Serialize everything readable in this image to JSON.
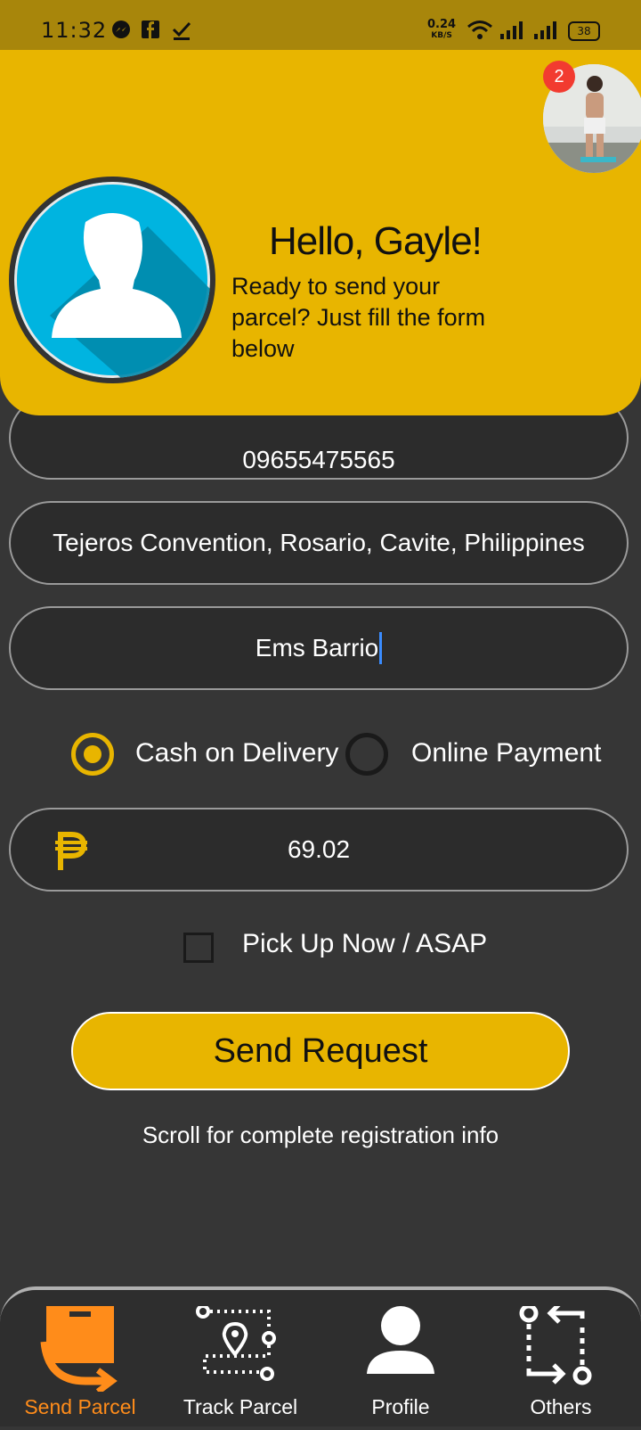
{
  "status_bar": {
    "time": "11:32",
    "speed_value": "0.24",
    "speed_unit": "KB/S",
    "battery": "38",
    "icons": [
      "messenger-icon",
      "facebook-icon",
      "check-icon",
      "wifi-icon",
      "signal-icon",
      "signal-icon",
      "battery-icon"
    ]
  },
  "header": {
    "notification_count": "2",
    "greeting": "Hello, Gayle!",
    "subtitle": "Ready to send your parcel? Just fill the form below"
  },
  "form": {
    "phone": "09655475565",
    "address": "Tejeros Convention, Rosario, Cavite, Philippines",
    "name": "Ems Barrio",
    "payment_options": [
      {
        "label": "Cash on Delivery",
        "selected": true
      },
      {
        "label": "Online Payment",
        "selected": false
      }
    ],
    "amount": "69.02",
    "currency_icon": "peso-icon",
    "pickup_label": "Pick Up Now / ASAP",
    "pickup_checked": false,
    "submit_label": "Send Request",
    "scroll_note": "Scroll for complete registration info"
  },
  "nav": {
    "items": [
      {
        "label": "Send Parcel",
        "icon": "parcel-icon",
        "active": true
      },
      {
        "label": "Track Parcel",
        "icon": "route-icon",
        "active": false
      },
      {
        "label": "Profile",
        "icon": "user-icon",
        "active": false
      },
      {
        "label": "Others",
        "icon": "swap-icon",
        "active": false
      }
    ]
  },
  "colors": {
    "accent": "#e8b500",
    "background": "#363636",
    "active_nav": "#ff8c1a"
  }
}
